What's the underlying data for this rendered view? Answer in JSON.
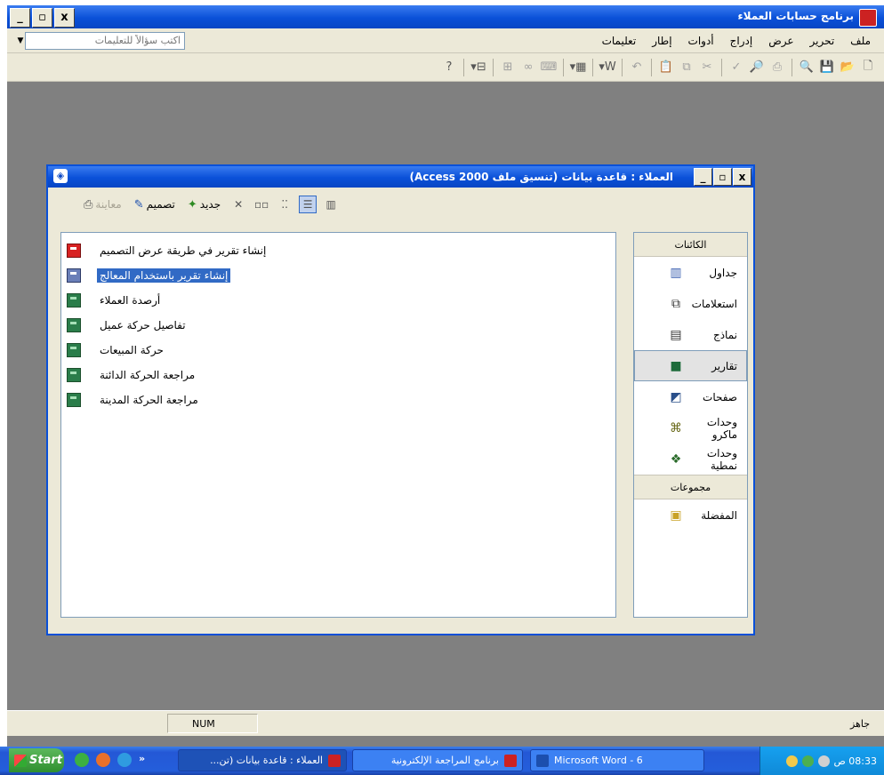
{
  "app": {
    "title": "برنامج حسابات العملاء",
    "controls": {
      "minimize": "_",
      "maximize": "▫",
      "close": "x"
    }
  },
  "menu": {
    "items": [
      "ملف",
      "تحرير",
      "عرض",
      "إدراج",
      "أدوات",
      "إطار",
      "تعليمات"
    ],
    "ask_placeholder": "اكتب سؤالاً للتعليمات"
  },
  "toolbar": {
    "icons": [
      "new-icon",
      "open-icon",
      "save-icon",
      "search-icon",
      "print-icon",
      "print-preview-icon",
      "spelling-icon",
      "cut-icon",
      "copy-icon",
      "paste-icon",
      "undo-icon",
      "office-links-icon",
      "analyze-icon",
      "code-icon",
      "properties-icon",
      "relationships-icon",
      "new-object-icon",
      "help-icon"
    ]
  },
  "db_window": {
    "title": "العملاء : قاعدة بيانات (تنسيق ملف Access 2000)",
    "tools": {
      "preview": "معاينة",
      "design": "تصميم",
      "new": "جديد"
    },
    "objects": [
      {
        "label": "إنشاء تقرير في طريقة عرض التصميم",
        "icon": "wizard-design-icon",
        "selected": false
      },
      {
        "label": "إنشاء تقرير باستخدام المعالج",
        "icon": "wizard-icon",
        "selected": true
      },
      {
        "label": "أرصدة العملاء",
        "icon": "report-icon",
        "selected": false
      },
      {
        "label": "تفاصيل حركة عميل",
        "icon": "report-icon",
        "selected": false
      },
      {
        "label": "حركة المبيعات",
        "icon": "report-icon",
        "selected": false
      },
      {
        "label": "مراجعة الحركة الدائنة",
        "icon": "report-icon",
        "selected": false
      },
      {
        "label": "مراجعة الحركة المدينة",
        "icon": "report-icon",
        "selected": false
      }
    ],
    "objects_group": "الكائنات",
    "object_types": [
      {
        "label": "جداول",
        "icon": "table-icon",
        "active": false
      },
      {
        "label": "استعلامات",
        "icon": "query-icon",
        "active": false
      },
      {
        "label": "نماذج",
        "icon": "form-icon",
        "active": false
      },
      {
        "label": "تقارير",
        "icon": "report-icon",
        "active": true
      },
      {
        "label": "صفحات",
        "icon": "page-icon",
        "active": false
      },
      {
        "label": "وحدات ماكرو",
        "icon": "macro-icon",
        "active": false
      },
      {
        "label": "وحدات نمطية",
        "icon": "module-icon",
        "active": false
      }
    ],
    "groups_header": "مجموعات",
    "favorites": "المفضلة"
  },
  "statusbar": {
    "ready": "جاهز",
    "num": "NUM"
  },
  "taskbar": {
    "start": "Start",
    "tasks": [
      {
        "label": "العملاء : قاعدة بيانات (تن...",
        "active": true
      },
      {
        "label": "برنامج المراجعة الإلكترونية",
        "active": false
      },
      {
        "label": "Microsoft Word - 6",
        "active": false
      }
    ],
    "clock": "08:33 ص"
  }
}
